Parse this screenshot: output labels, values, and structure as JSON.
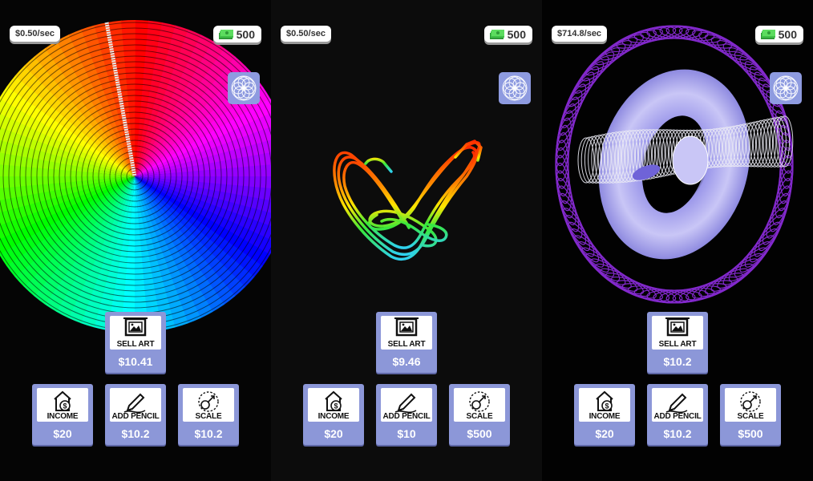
{
  "panels": [
    {
      "rate": "$0.50/sec",
      "cash": "500",
      "buttons": {
        "sell": {
          "label": "SELL ART",
          "price": "$10.41"
        },
        "income": {
          "label": "INCOME",
          "price": "$20"
        },
        "pencil": {
          "label": "ADD PENCIL",
          "price": "$10.2"
        },
        "scale": {
          "label": "SCALE",
          "price": "$10.2"
        }
      }
    },
    {
      "rate": "$0.50/sec",
      "cash": "500",
      "buttons": {
        "sell": {
          "label": "SELL ART",
          "price": "$9.46"
        },
        "income": {
          "label": "INCOME",
          "price": "$20"
        },
        "pencil": {
          "label": "ADD PENCIL",
          "price": "$10"
        },
        "scale": {
          "label": "SCALE",
          "price": "$500"
        }
      }
    },
    {
      "rate": "$714.8/sec",
      "cash": "500",
      "buttons": {
        "sell": {
          "label": "SELL ART",
          "price": "$10.2"
        },
        "income": {
          "label": "INCOME",
          "price": "$20"
        },
        "pencil": {
          "label": "ADD PENCIL",
          "price": "$10.2"
        },
        "scale": {
          "label": "SCALE",
          "price": "$500"
        }
      }
    }
  ],
  "icons": {
    "cash": "money-stack-icon",
    "spiro": "spirograph-icon",
    "sell": "framed-picture-icon",
    "income": "house-dollar-icon",
    "pencil": "pencil-icon",
    "scale": "scale-arrow-icon"
  },
  "colors": {
    "button_bg": "#8c97d8",
    "spiro_button_bg": "#8e9be0",
    "art2_gradient": [
      "#ff2a00",
      "#ffe600",
      "#38e83a",
      "#2fd1f0"
    ],
    "art3_ring": "#8a2cd8",
    "art3_torus": "#b9b6f2"
  }
}
